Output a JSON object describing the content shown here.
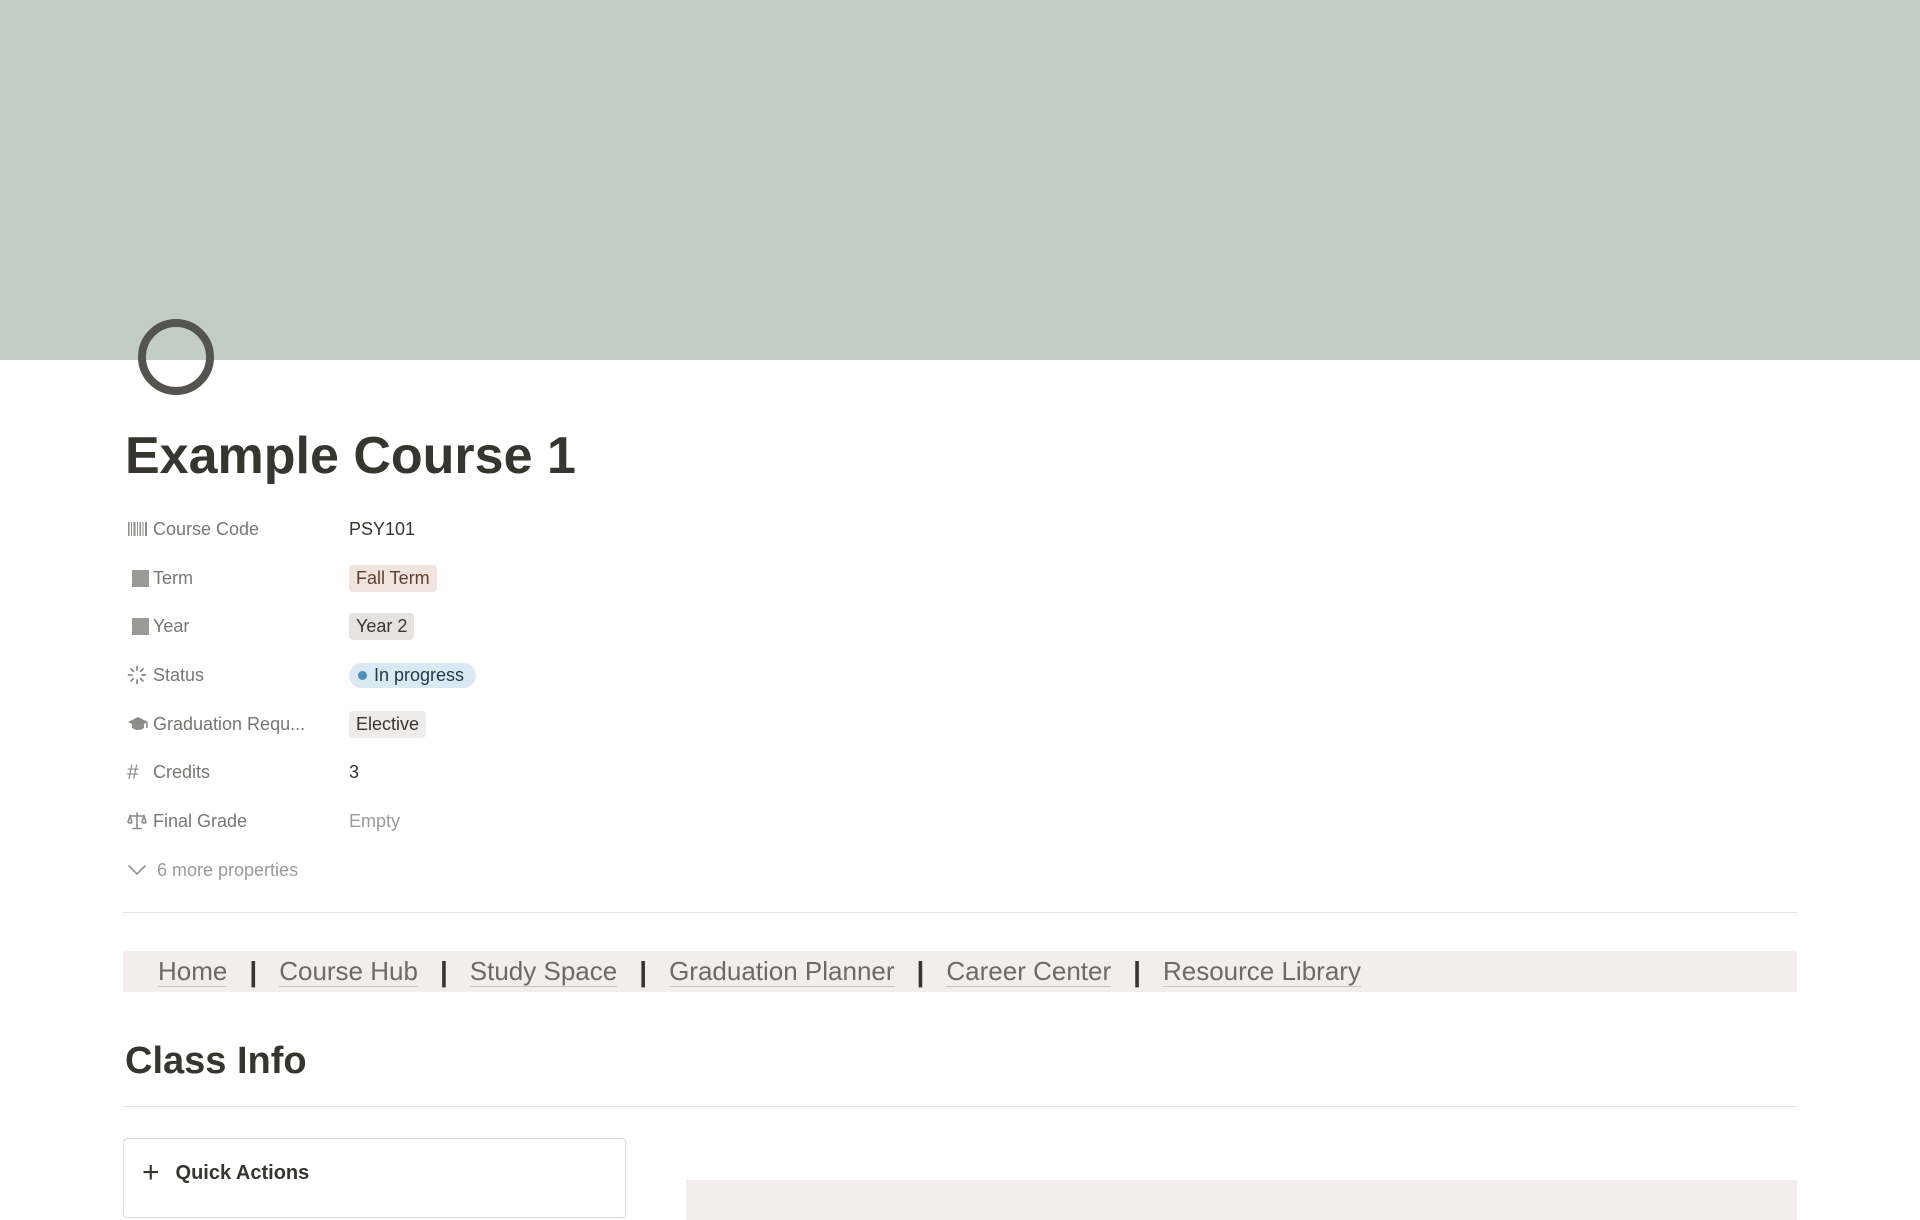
{
  "page": {
    "title": "Example Course 1"
  },
  "properties": [
    {
      "label": "Course Code",
      "value": "PSY101",
      "icon": "barcode-icon"
    },
    {
      "label": "Term",
      "value": "Fall Term",
      "icon": "select-icon"
    },
    {
      "label": "Year",
      "value": "Year 2",
      "icon": "select-icon"
    },
    {
      "label": "Status",
      "value": "In progress",
      "icon": "status-icon"
    },
    {
      "label": "Graduation Requ...",
      "value": "Elective",
      "icon": "graduation-cap-icon"
    },
    {
      "label": "Credits",
      "value": "3",
      "icon": "hash-icon"
    },
    {
      "label": "Final Grade",
      "value": "Empty",
      "icon": "scale-icon"
    }
  ],
  "more_properties": "6 more properties",
  "nav": [
    {
      "label": "Home"
    },
    {
      "label": "Course Hub"
    },
    {
      "label": "Study Space"
    },
    {
      "label": "Graduation Planner"
    },
    {
      "label": "Career Center"
    },
    {
      "label": "Resource Library"
    }
  ],
  "nav_separator": "|",
  "sections": {
    "class_info": "Class Info"
  },
  "quick_actions": {
    "label": "Quick Actions"
  },
  "colors": {
    "cover": "#c2cdc3",
    "nav_background": "#f3eeed",
    "status_dot": "#4d8fbf"
  }
}
